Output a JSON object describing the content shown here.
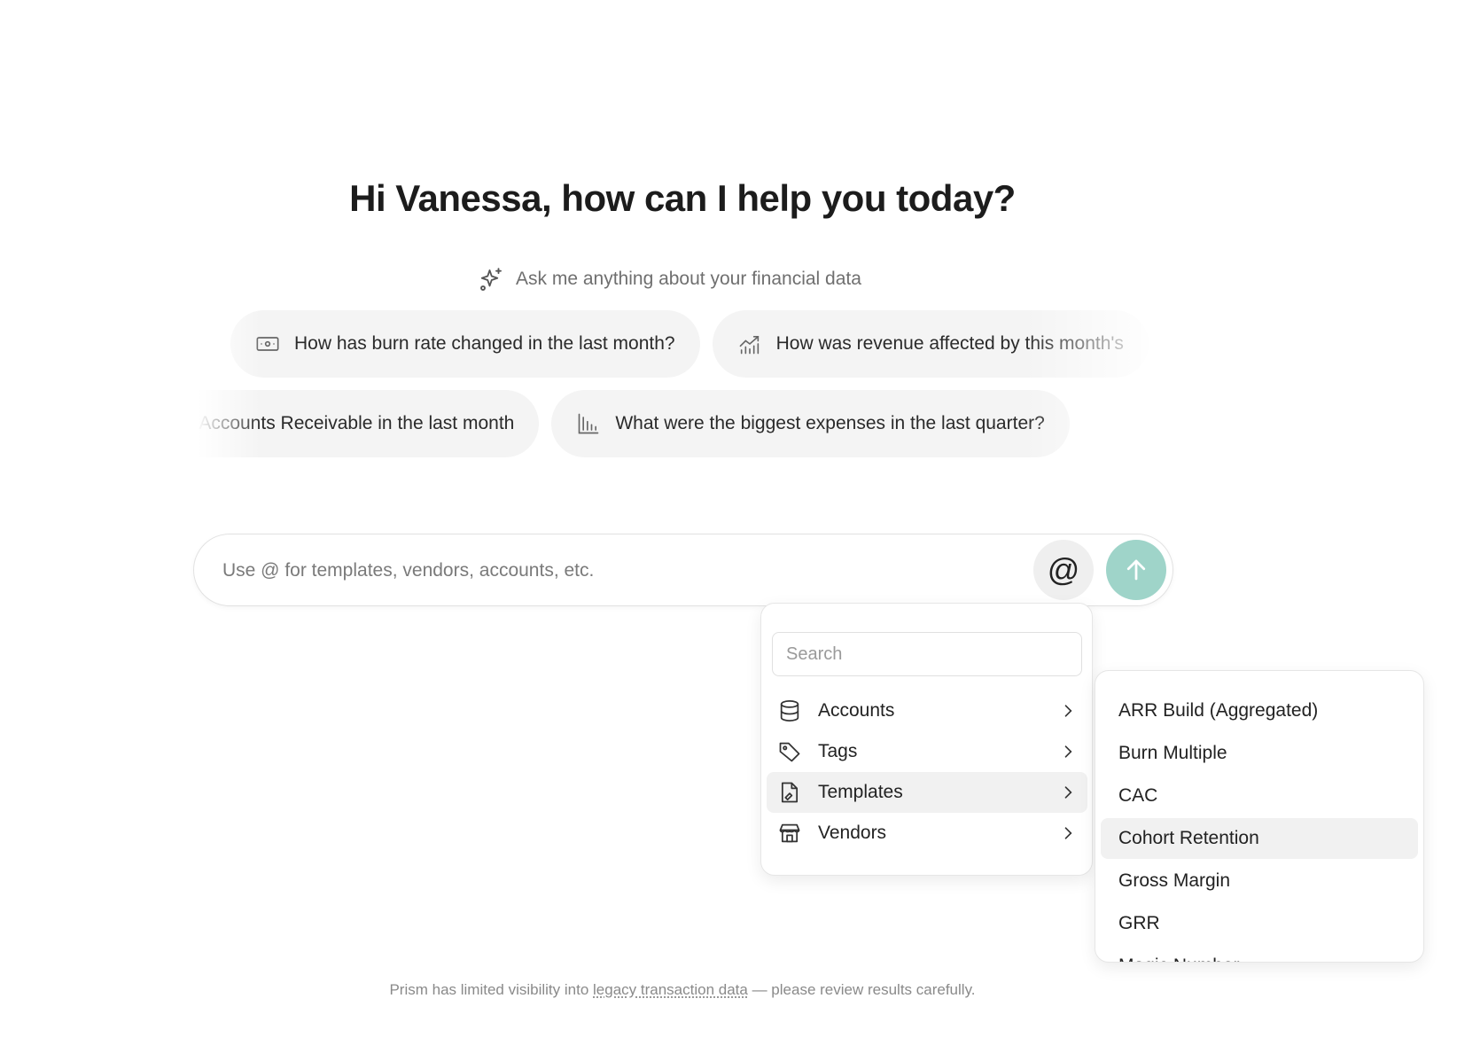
{
  "greeting": "Hi Vanessa, how can I help you today?",
  "subtitle": {
    "icon": "sparkles-icon",
    "text": "Ask me anything about your financial data"
  },
  "suggestions": {
    "row1": [
      {
        "icon": "banknote-icon",
        "text": "How has burn rate changed in the last month?"
      },
      {
        "icon": "chart-trend-icon",
        "text": "How was revenue affected by this month's"
      }
    ],
    "row2": [
      {
        "icon": "",
        "text": "@Accounts Receivable in the last month"
      },
      {
        "icon": "bar-chart-icon",
        "text": "What were the biggest expenses in the last quarter?"
      }
    ]
  },
  "input": {
    "placeholder": "Use @ for templates, vendors, accounts, etc.",
    "mention_label": "@"
  },
  "mention_menu": {
    "search_placeholder": "Search",
    "items": [
      {
        "icon": "database-icon",
        "label": "Accounts"
      },
      {
        "icon": "tag-icon",
        "label": "Tags"
      },
      {
        "icon": "file-template-icon",
        "label": "Templates"
      },
      {
        "icon": "store-icon",
        "label": "Vendors"
      }
    ],
    "active_item": "Templates"
  },
  "templates_submenu": {
    "items": [
      "ARR Build (Aggregated)",
      "Burn Multiple",
      "CAC",
      "Cohort Retention",
      "Gross Margin",
      "GRR",
      "Magic Number"
    ],
    "highlighted": "Cohort Retention"
  },
  "disclaimer": {
    "prefix": "Prism has limited visibility into ",
    "link": "legacy transaction data",
    "suffix": " — please review results carefully."
  },
  "colors": {
    "send_button": "#9fd4c9",
    "chip_bg": "#f4f4f4",
    "highlight_bg": "#f1f1f1"
  }
}
